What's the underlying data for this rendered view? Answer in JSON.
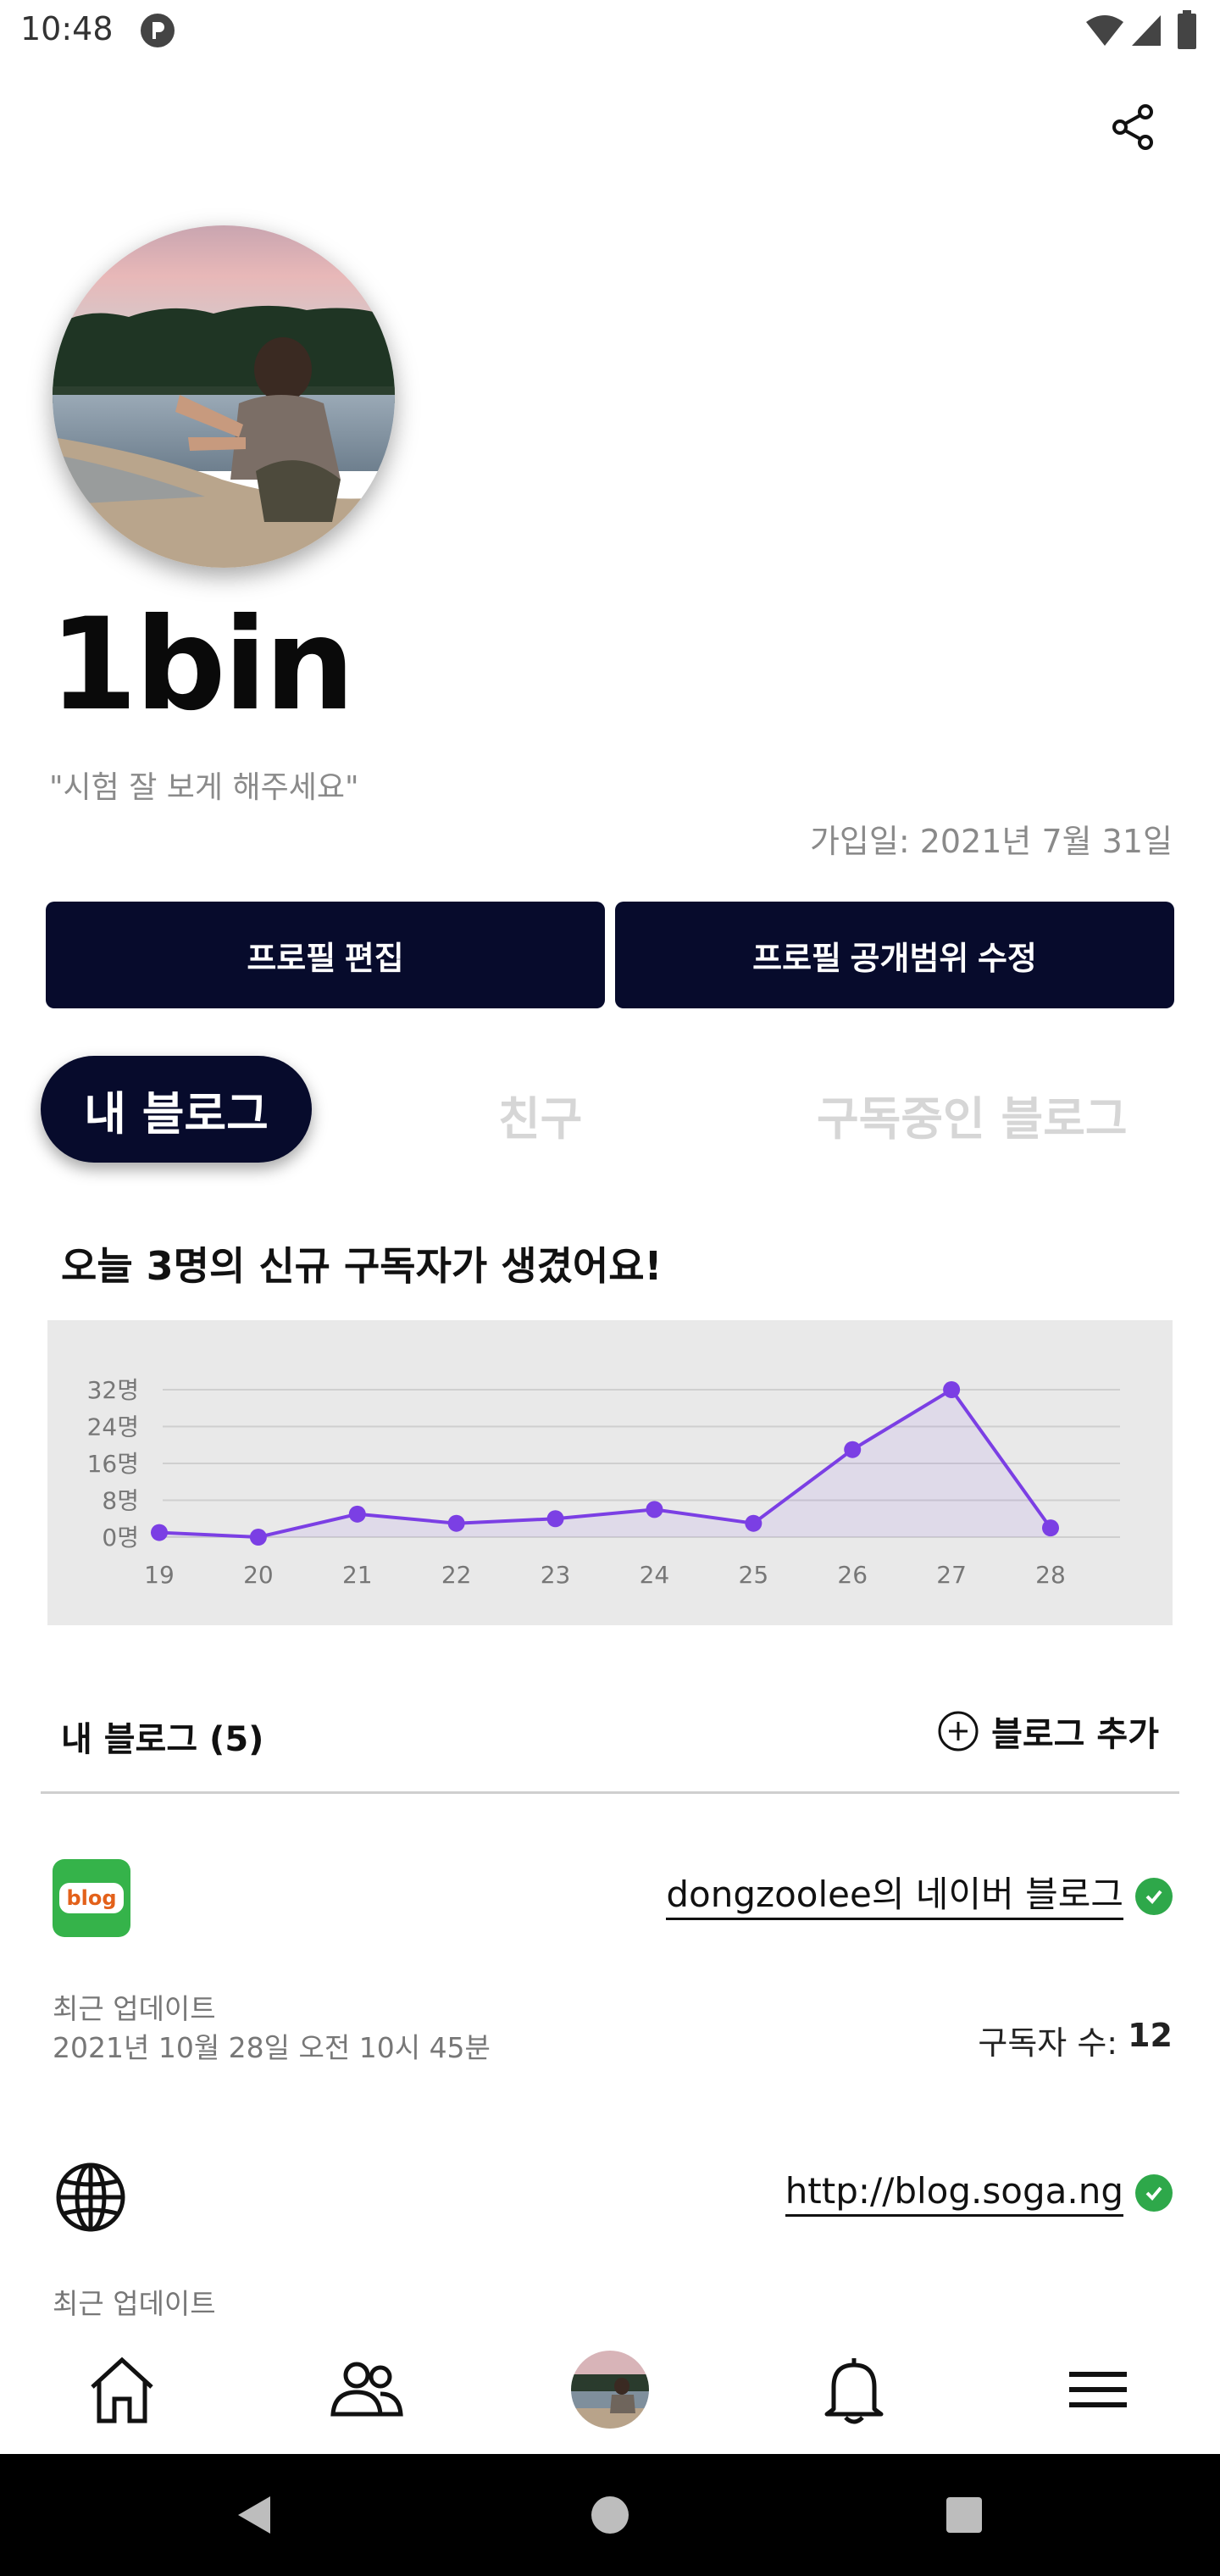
{
  "status_bar": {
    "time": "10:48"
  },
  "profile": {
    "username": "1bin",
    "bio": "\"시험 잘 보게 해주세요\"",
    "join_date": "가입일: 2021년 7월 31일",
    "edit_button": "프로필 편집",
    "visibility_button": "프로필 공개범위 수정"
  },
  "tabs": [
    {
      "label": "내 블로그",
      "active": true
    },
    {
      "label": "친구",
      "active": false
    },
    {
      "label": "구독중인 블로그",
      "active": false
    }
  ],
  "chart_headline": "오늘 3명의 신규 구독자가 생겼어요!",
  "chart_data": {
    "type": "area",
    "categories": [
      "19",
      "20",
      "21",
      "22",
      "23",
      "24",
      "25",
      "26",
      "27",
      "28"
    ],
    "series": [
      {
        "values": [
          1,
          0,
          5,
          3,
          4,
          6,
          3,
          19,
          32,
          2
        ]
      }
    ],
    "y_ticks": [
      "0명",
      "8명",
      "16명",
      "24명",
      "32명"
    ],
    "ylim": [
      0,
      32
    ],
    "grid": true,
    "line_color": "#7b3fe4"
  },
  "blogs_section": {
    "title": "내 블로그 (5)",
    "add_label": "블로그 추가",
    "items": [
      {
        "icon": "naver-blog-icon",
        "icon_text": "blog",
        "name": "dongzoolee의 네이버 블로그",
        "verified": true,
        "update_label": "최근 업데이트",
        "update_time": "2021년 10월 28일 오전 10시 45분",
        "subscriber_label": "구독자 수:",
        "subscriber_count": "12"
      },
      {
        "icon": "globe-icon",
        "name": "http://blog.soga.ng",
        "verified": true,
        "update_label": "최근 업데이트"
      }
    ]
  },
  "colors": {
    "primary": "#070b2c",
    "chart_line": "#7b3fe4",
    "verified": "#2ea84a"
  }
}
